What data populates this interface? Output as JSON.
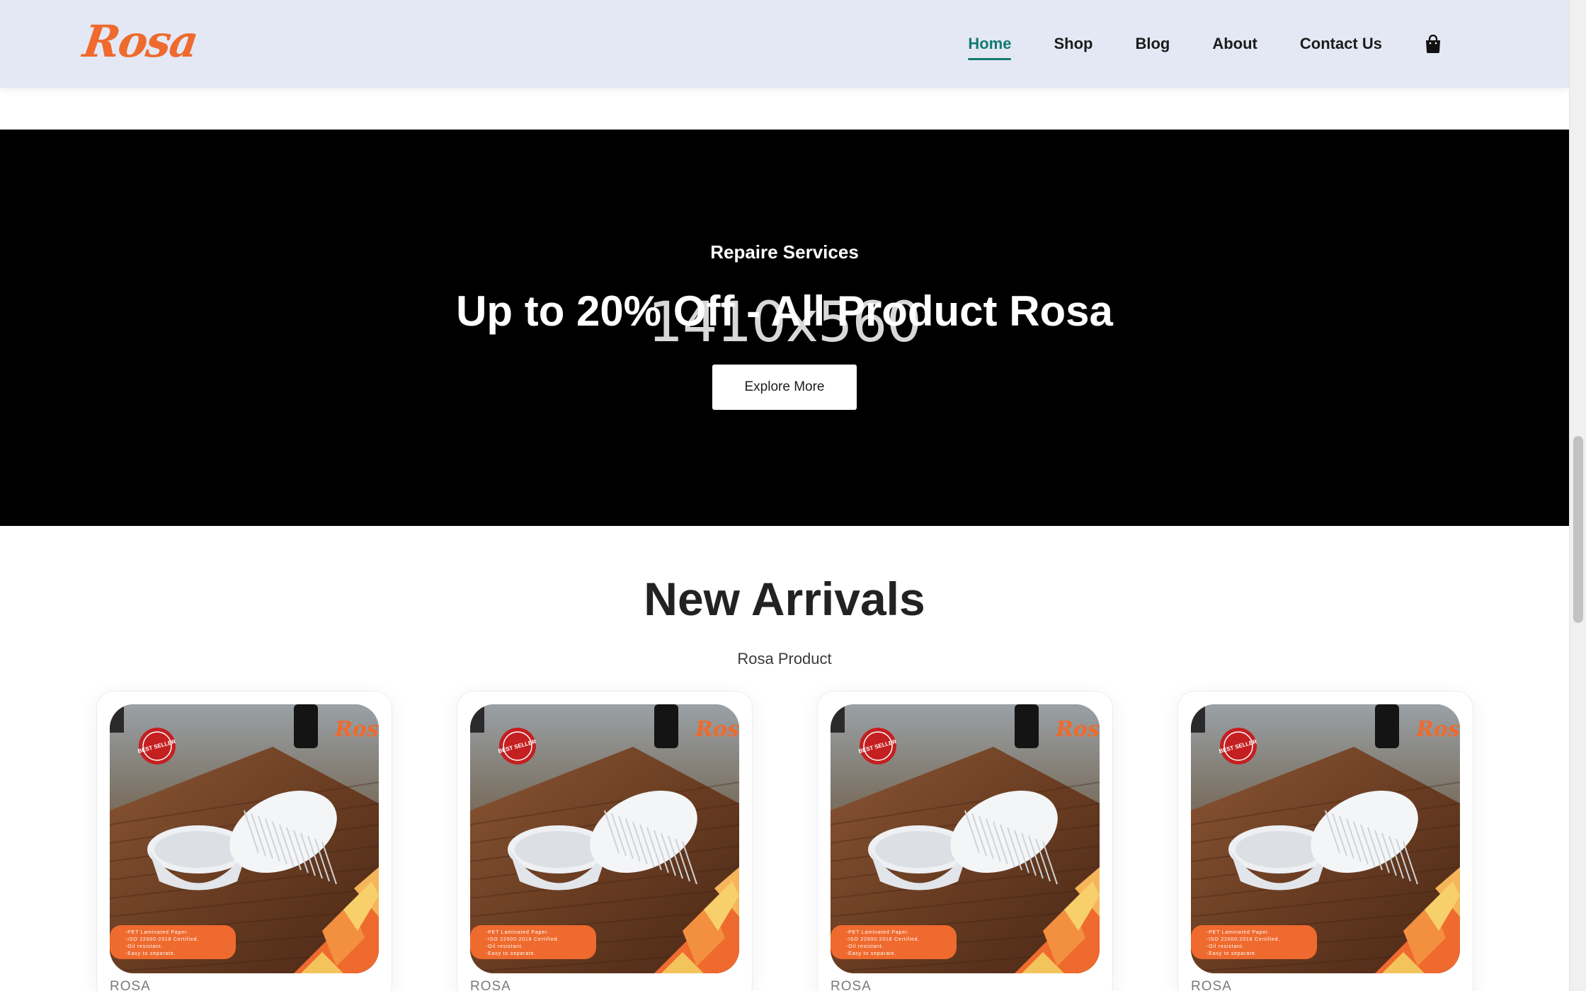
{
  "header": {
    "logo_text": "Rosa",
    "nav": [
      {
        "label": "Home",
        "active": true
      },
      {
        "label": "Shop",
        "active": false
      },
      {
        "label": "Blog",
        "active": false
      },
      {
        "label": "About",
        "active": false
      },
      {
        "label": "Contact Us",
        "active": false
      }
    ],
    "cart_icon": "shopping-bag-icon"
  },
  "hero": {
    "placeholder_text": "1410x560",
    "subtitle": "Repaire Services",
    "title": "Up to 20% Off - All Product Rosa",
    "button_label": "Explore More"
  },
  "section": {
    "title": "New Arrivals",
    "subtitle": "Rosa Product"
  },
  "products": [
    {
      "brand": "ROSA",
      "badge": "BEST SELLER",
      "logo": "Rosa",
      "features": [
        "-PET Laminated Paper.",
        "-ISO 22000:2018 Certified.",
        "-Oil resistant.",
        "-Easy to separate."
      ]
    },
    {
      "brand": "ROSA",
      "badge": "BEST SELLER",
      "logo": "Rosa",
      "features": [
        "-PET Laminated Paper.",
        "-ISO 22000:2018 Certified.",
        "-Oil resistant.",
        "-Easy to separate."
      ]
    },
    {
      "brand": "ROSA",
      "badge": "BEST SELLER",
      "logo": "Rosa",
      "features": [
        "-PET Laminated Paper.",
        "-ISO 22000:2018 Certified.",
        "-Oil resistant.",
        "-Easy to separate."
      ]
    },
    {
      "brand": "ROSA",
      "badge": "BEST SELLER",
      "logo": "Rosa",
      "features": [
        "-PET Laminated Paper.",
        "-ISO 22000:2018 Certified.",
        "-Oil resistant.",
        "-Easy to separate."
      ]
    }
  ],
  "colors": {
    "brand_orange": "#ef6a2e",
    "nav_active": "#147a72",
    "header_bg": "#e4e8f4",
    "hero_bg": "#000000"
  }
}
